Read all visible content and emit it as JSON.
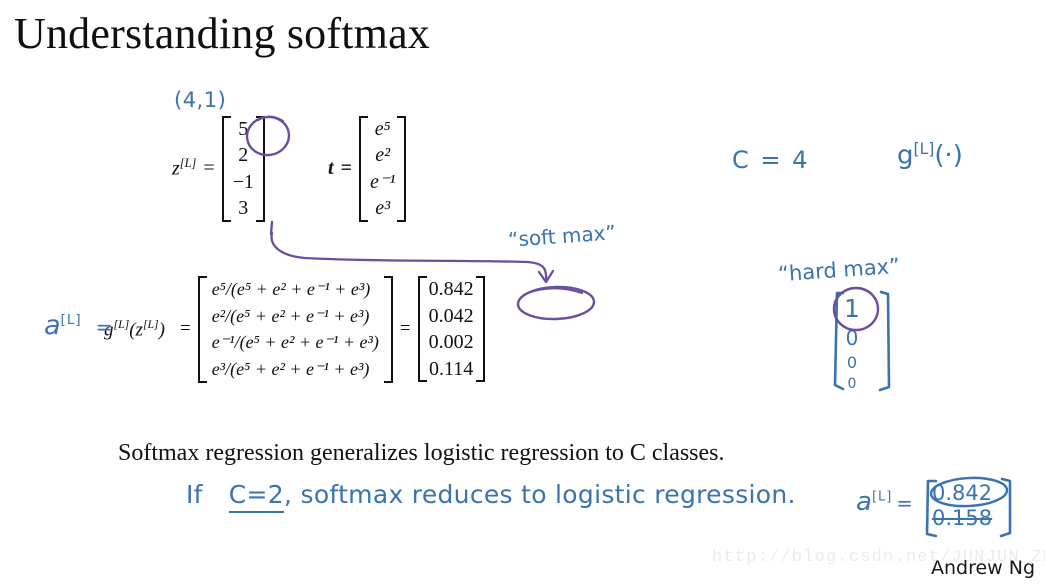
{
  "slide": {
    "title": "Understanding softmax",
    "caption": "Softmax regression generalizes logistic regression to C classes.",
    "footer_author": "Andrew Ng",
    "watermark": "http://blog.csdn.net/JUNJUN_ZHAO"
  },
  "colors": {
    "ink_blue": "#3b72b0",
    "ink_purple": "#6b4f9e",
    "text": "#111111",
    "background": "#ffffff",
    "watermark": "#ebebeb"
  },
  "equations": {
    "z": {
      "label": "z",
      "label_sup": "[L]",
      "equals": "=",
      "values": [
        "5",
        "2",
        "−1",
        "3"
      ]
    },
    "t": {
      "label": "t",
      "equals": "=",
      "values": [
        "e⁵",
        "e²",
        "e⁻¹",
        "e³"
      ]
    },
    "main": {
      "lhs": "g",
      "lhs_sup": "[L]",
      "lhs_arg": "(z",
      "lhs_arg_sup": "[L]",
      "lhs_arg_close": ")",
      "equals": "=",
      "rows": [
        "e⁵/(e⁵ + e² + e⁻¹ + e³)",
        "e²/(e⁵ + e² + e⁻¹ + e³)",
        "e⁻¹/(e⁵ + e² + e⁻¹ + e³)",
        "e³/(e⁵ + e² + e⁻¹ + e³)"
      ],
      "equals2": "=",
      "results": [
        "0.842",
        "0.042",
        "0.002",
        "0.114"
      ]
    }
  },
  "annotations": {
    "shape_41": "(4,1)",
    "c_equals": "C = 4",
    "g_of": "g",
    "g_of_sup": "[L]",
    "g_of_tail": "(·)",
    "soft_max": "“soft max”",
    "hard_max": "“hard max”",
    "a_label": "a",
    "a_label_sup": "[L]",
    "a_label_equals": "=",
    "hard_max_values": [
      "1",
      "0",
      "0",
      "0"
    ],
    "bottom_line_if": "If",
    "bottom_line_c2": "C=2",
    "bottom_line_rest": ",   softmax   reduces to   logistic  regression.",
    "bottom_a_label": "a",
    "bottom_a_sup": "[L]",
    "bottom_a_equals": "=",
    "bottom_a_values": [
      "0.842",
      "0.158"
    ]
  }
}
